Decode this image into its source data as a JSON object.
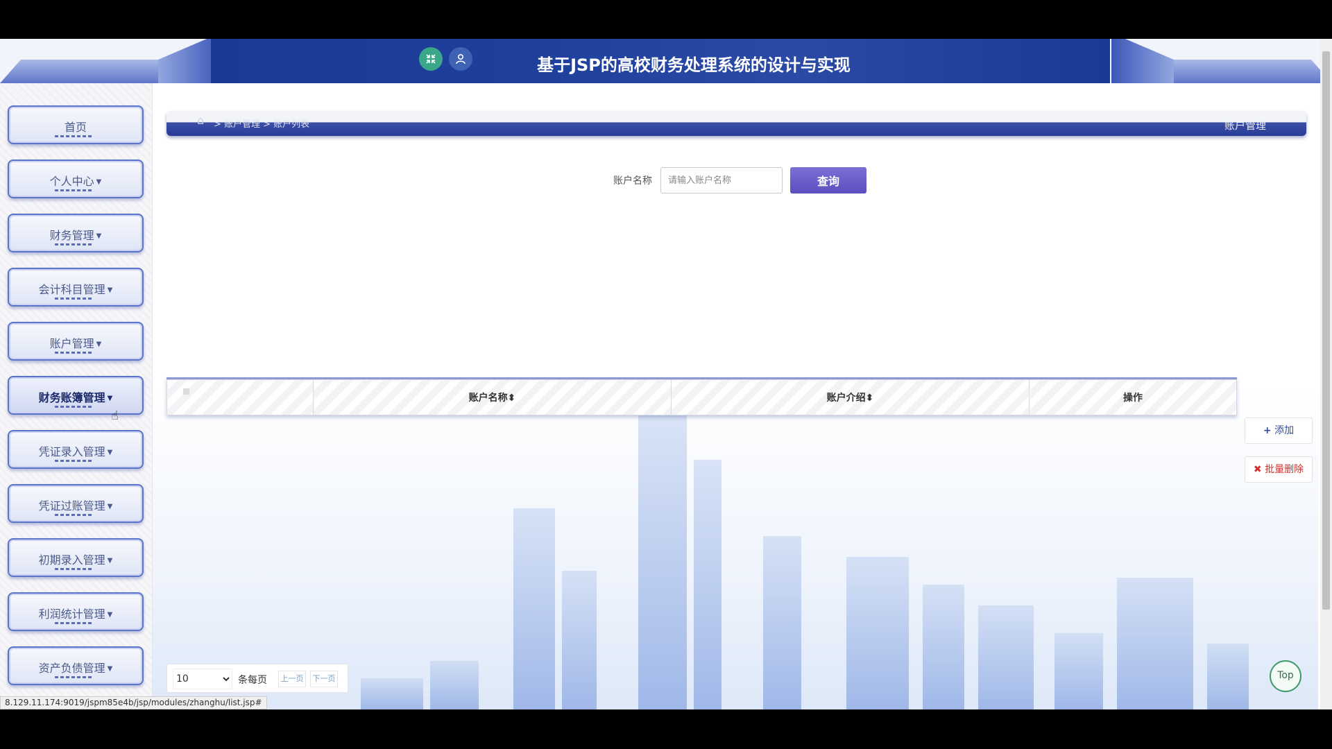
{
  "header": {
    "title": "基于JSP的高校财务处理系统的设计与实现",
    "icons": [
      "shrink-icon",
      "user-icon"
    ],
    "accent_color": "#1b3a93"
  },
  "sidebar": {
    "items": [
      {
        "label": "首页",
        "has_caret": false
      },
      {
        "label": "个人中心",
        "has_caret": true
      },
      {
        "label": "财务管理",
        "has_caret": true
      },
      {
        "label": "会计科目管理",
        "has_caret": true
      },
      {
        "label": "账户管理",
        "has_caret": true
      },
      {
        "label": "财务账簿管理",
        "has_caret": true,
        "active": true
      },
      {
        "label": "凭证录入管理",
        "has_caret": true
      },
      {
        "label": "凭证过账管理",
        "has_caret": true
      },
      {
        "label": "初期录入管理",
        "has_caret": true
      },
      {
        "label": "利润统计管理",
        "has_caret": true
      },
      {
        "label": "资产负债管理",
        "has_caret": true
      }
    ]
  },
  "breadcrumb": {
    "path": "> 账户管理 > 账户列表",
    "page_title": "账户管理"
  },
  "search": {
    "label": "账户名称",
    "placeholder": "请输入账户名称",
    "value": "",
    "button_label": "查询"
  },
  "table": {
    "columns": [
      "",
      "账户名称",
      "账户介绍",
      "操作"
    ],
    "rows": []
  },
  "actions": {
    "add_label": "添加",
    "batch_delete_label": "批量删除"
  },
  "pager": {
    "page_size": "10",
    "per_page_label": "条每页",
    "prev_label": "上一页",
    "next_label": "下一页"
  },
  "top_button": "Top",
  "status_url": "8.129.11.174:9019/jspm85e4b/jsp/modules/zhanghu/list.jsp#"
}
